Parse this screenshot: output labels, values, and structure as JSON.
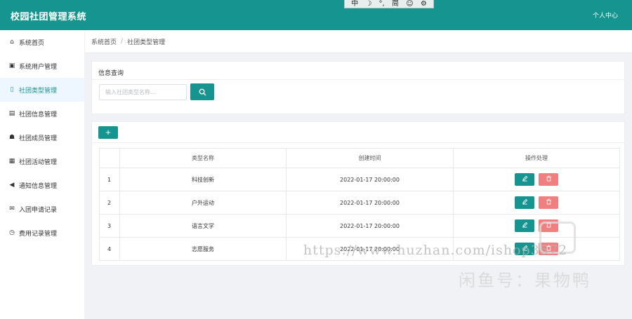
{
  "app": {
    "title": "校园社团管理系统",
    "user_center": "个人中心",
    "brand_color": "#159490"
  },
  "ime_toolbar": {
    "items": [
      "中",
      "☽",
      "°,",
      "简",
      "☺",
      "⚙"
    ]
  },
  "sidebar": {
    "items": [
      {
        "label": "系统首页",
        "icon": "home-icon",
        "glyph": "⌂"
      },
      {
        "label": "系统用户管理",
        "icon": "user-card-icon",
        "glyph": "▣"
      },
      {
        "label": "社团类型管理",
        "icon": "document-icon",
        "glyph": "▯",
        "active": true
      },
      {
        "label": "社团信息管理",
        "icon": "bus-icon",
        "glyph": "▤"
      },
      {
        "label": "社团成员管理",
        "icon": "users-icon",
        "glyph": "☗"
      },
      {
        "label": "社团活动管理",
        "icon": "calculator-icon",
        "glyph": "▦"
      },
      {
        "label": "通知信息管理",
        "icon": "bullhorn-icon",
        "glyph": "◀"
      },
      {
        "label": "入团申请记录",
        "icon": "envelope-open-icon",
        "glyph": "✉"
      },
      {
        "label": "费用记录管理",
        "icon": "clock-icon",
        "glyph": "◷"
      }
    ]
  },
  "breadcrumb": {
    "home": "系统首页",
    "separator": "/",
    "current": "社团类型管理"
  },
  "query": {
    "title": "信息查询",
    "placeholder": "输入社团类型名称...",
    "value": "",
    "search_icon": "search-icon"
  },
  "table": {
    "add_label": "+",
    "columns": [
      "",
      "类型名称",
      "创建时间",
      "操作处理"
    ],
    "rows": [
      {
        "index": "1",
        "name": "科技创新",
        "created": "2022-01-17 20:00:00"
      },
      {
        "index": "2",
        "name": "户外运动",
        "created": "2022-01-17 20:00:00"
      },
      {
        "index": "3",
        "name": "语言文学",
        "created": "2022-01-17 20:00:00"
      },
      {
        "index": "4",
        "name": "志愿服务",
        "created": "2022-01-17 20:00:00"
      }
    ],
    "edit_icon": "edit-icon",
    "delete_icon": "trash-icon",
    "edit_color": "#159490",
    "delete_color": "#f07f7f"
  },
  "watermark": {
    "url": "https://www.huzhan.com/ishop3572",
    "fish": "闲鱼号：果物鸭"
  }
}
